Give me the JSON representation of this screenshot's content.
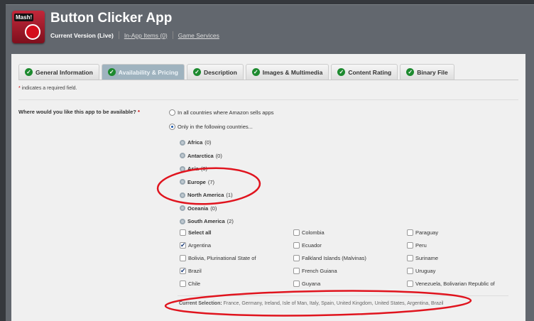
{
  "app": {
    "logo_text": "Mash!",
    "title": "Button Clicker App",
    "current_version": "Current Version (Live)",
    "links": [
      "In-App Items (0)",
      "Game Services"
    ]
  },
  "tabs": [
    {
      "label": "General Information"
    },
    {
      "label": "Availability & Pricing",
      "active": true
    },
    {
      "label": "Description"
    },
    {
      "label": "Images & Multimedia"
    },
    {
      "label": "Content Rating"
    },
    {
      "label": "Binary File"
    }
  ],
  "required_note": "indicates a required field.",
  "question": "Where would you like this app to be available?",
  "options": [
    "In all countries where Amazon sells apps",
    "Only in the following countries..."
  ],
  "selected_option": 1,
  "regions": [
    {
      "name": "Africa",
      "count": "(0)"
    },
    {
      "name": "Antarctica",
      "count": "(0)"
    },
    {
      "name": "Asia",
      "count": "(0)"
    },
    {
      "name": "Europe",
      "count": "(7)"
    },
    {
      "name": "North America",
      "count": "(1)"
    },
    {
      "name": "Oceania",
      "count": "(0)"
    },
    {
      "name": "South America",
      "count": "(2)"
    }
  ],
  "countries": [
    [
      {
        "label": "Select all",
        "checked": false
      },
      {
        "label": "Argentina",
        "checked": true
      },
      {
        "label": "Bolivia, Plurinational State of",
        "checked": false
      },
      {
        "label": "Brazil",
        "checked": true
      },
      {
        "label": "Chile",
        "checked": false
      }
    ],
    [
      {
        "label": "Colombia",
        "checked": false
      },
      {
        "label": "Ecuador",
        "checked": false
      },
      {
        "label": "Falkland Islands (Malvinas)",
        "checked": false
      },
      {
        "label": "French Guiana",
        "checked": false
      },
      {
        "label": "Guyana",
        "checked": false
      }
    ],
    [
      {
        "label": "Paraguay",
        "checked": false
      },
      {
        "label": "Peru",
        "checked": false
      },
      {
        "label": "Suriname",
        "checked": false
      },
      {
        "label": "Uruguay",
        "checked": false
      },
      {
        "label": "Venezuela, Bolivarian Republic of",
        "checked": false
      }
    ]
  ],
  "current_selection": {
    "label": "Current Selection:",
    "value": "France, Germany, Ireland, Isle of Man, Italy, Spain, United Kingdom, United States, Argentina, Brazil"
  },
  "colors": {
    "annotation": "#e0141e",
    "accent_tab": "#9fb3bf",
    "check": "#1d8a2f"
  }
}
